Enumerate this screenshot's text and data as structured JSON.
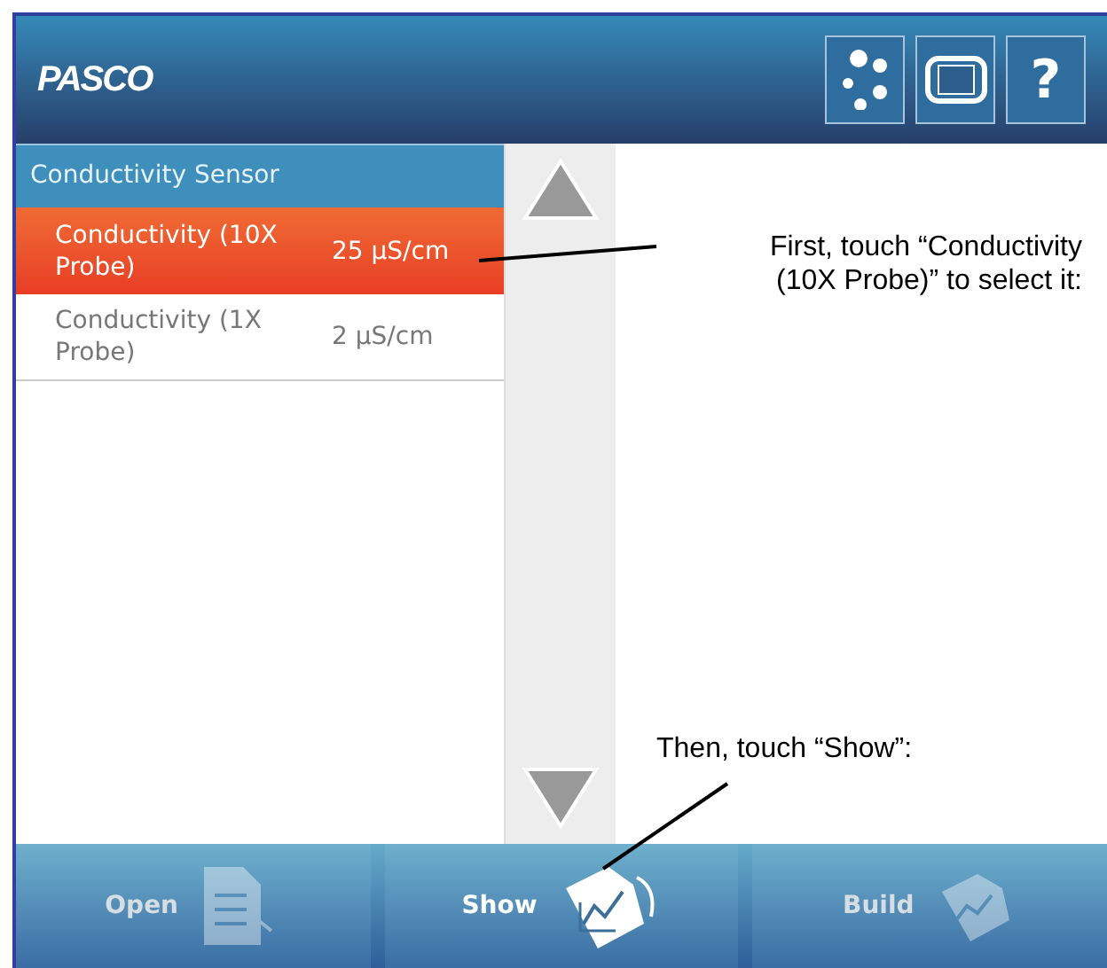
{
  "header": {
    "logo": "PASCO",
    "help": "?"
  },
  "sensor_list": {
    "group": "Conductivity Sensor",
    "items": [
      {
        "name": "Conductivity (10X Probe)",
        "reading": "25 µS/cm",
        "selected": true
      },
      {
        "name": "Conductivity (1X Probe)",
        "reading": "2 µS/cm",
        "selected": false
      }
    ]
  },
  "bottom_bar": [
    {
      "label": "Open",
      "kind": "open",
      "disabled": true
    },
    {
      "label": "Show",
      "kind": "show",
      "disabled": false
    },
    {
      "label": "Build",
      "kind": "build",
      "disabled": true
    }
  ],
  "callouts": [
    {
      "lines": [
        "First, touch “Conductivity",
        "(10X Probe)” to select it:"
      ]
    },
    {
      "lines": [
        "Then, touch “Show”:"
      ]
    }
  ]
}
